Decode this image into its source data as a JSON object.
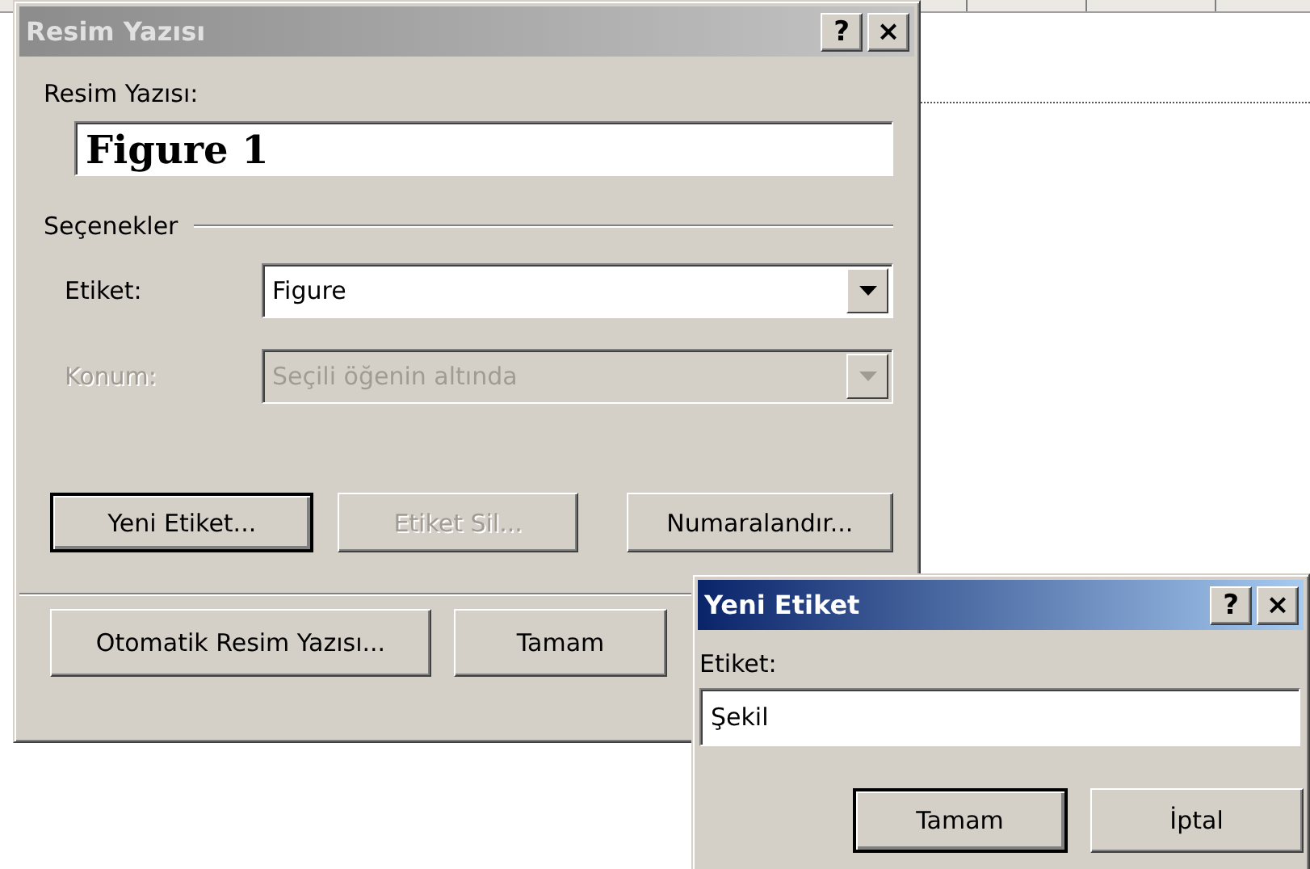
{
  "caption_dialog": {
    "title": "Resim Yazısı",
    "active": false,
    "help_button": "?",
    "close_button": "×",
    "caption_label": "Resim Yazısı:",
    "caption_value": "Figure 1",
    "options_group": "Seçenekler",
    "fields": [
      {
        "label": "Etiket:",
        "value": "Figure",
        "disabled": false
      },
      {
        "label": "Konum:",
        "value": "Seçili öğenin altında",
        "disabled": true
      }
    ],
    "buttons": [
      {
        "label": "Yeni Etiket...",
        "disabled": false,
        "default": true
      },
      {
        "label": "Etiket Sil...",
        "disabled": true,
        "default": false
      },
      {
        "label": "Numaralandır...",
        "disabled": false,
        "default": false
      }
    ],
    "footer_buttons": [
      {
        "label": "Otomatik Resim Yazısı...",
        "disabled": false,
        "default": false
      },
      {
        "label": "Tamam",
        "disabled": false,
        "default": false
      }
    ]
  },
  "new_label_dialog": {
    "title": "Yeni Etiket",
    "active": true,
    "help_button": "?",
    "close_button": "×",
    "field_label": "Etiket:",
    "field_value": "Şekil",
    "buttons": [
      {
        "label": "Tamam",
        "disabled": false,
        "default": true
      },
      {
        "label": "İptal",
        "disabled": false,
        "default": false
      }
    ]
  }
}
